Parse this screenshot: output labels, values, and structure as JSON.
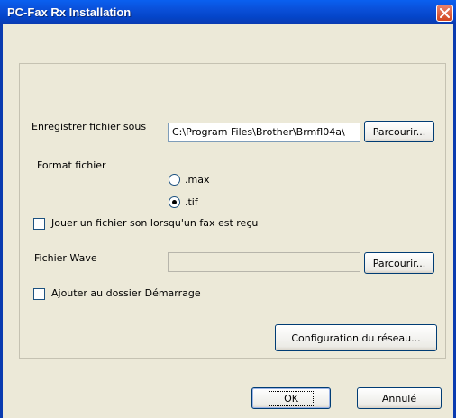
{
  "window": {
    "title": "PC-Fax Rx Installation"
  },
  "save_location": {
    "label": "Enregistrer fichier sous",
    "value": "C:\\Program Files\\Brother\\Brmfl04a\\",
    "browse_label": "Parcourir..."
  },
  "file_format": {
    "label": "Format fichier",
    "options": [
      {
        "label": ".max",
        "selected": false
      },
      {
        "label": ".tif",
        "selected": true
      }
    ]
  },
  "play_sound": {
    "label": "Jouer un fichier son lorsqu'un fax est reçu",
    "checked": false
  },
  "wave_file": {
    "label": "Fichier Wave",
    "value": "",
    "browse_label": "Parcourir..."
  },
  "startup": {
    "label": "Ajouter au dossier Démarrage",
    "checked": false
  },
  "network_button": "Configuration du réseau...",
  "footer": {
    "ok_label": "OK",
    "cancel_label": "Annulé"
  }
}
